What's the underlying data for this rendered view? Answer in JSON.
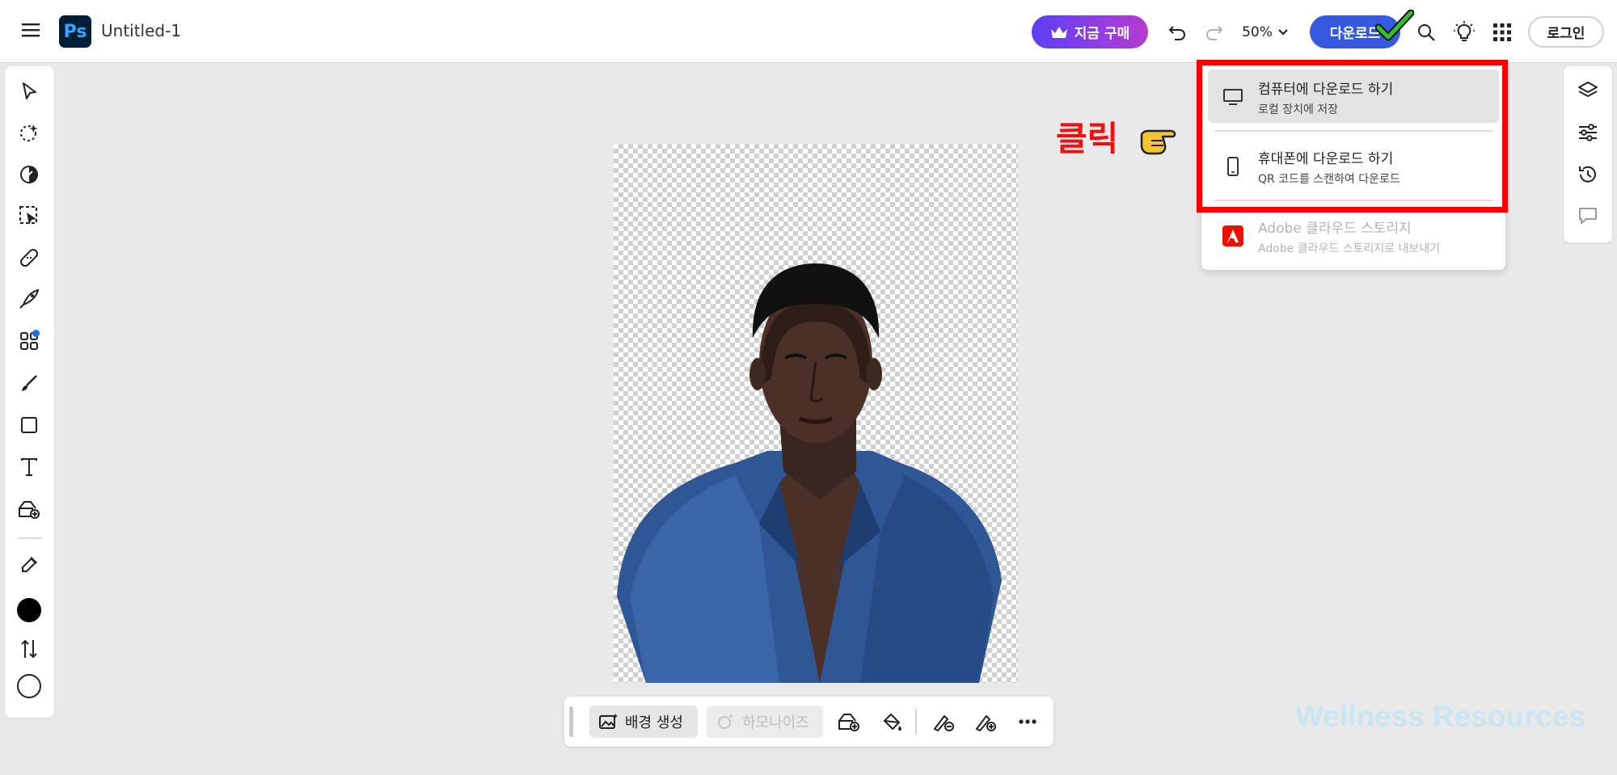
{
  "header": {
    "app_icon_label": "Ps",
    "doc_title": "Untitled-1",
    "buy_label": "지금 구매",
    "zoom_level": "50%",
    "download_label": "다운로드",
    "login_label": "로그인"
  },
  "download_menu": {
    "items": [
      {
        "title": "컴퓨터에 다운로드 하기",
        "subtitle": "로컬 장치에 저장",
        "icon": "monitor-icon",
        "active": true
      },
      {
        "title": "휴대폰에 다운로드 하기",
        "subtitle": "QR 코드를 스캔하여 다운로드",
        "icon": "phone-icon",
        "active": false
      },
      {
        "title": "Adobe 클라우드 스토리지",
        "subtitle": "Adobe 클라우드 스토리지로 내보내기",
        "icon": "adobe-icon",
        "disabled": true
      }
    ]
  },
  "annotation": {
    "click_label": "클릭",
    "highlight_color": "#ff0000",
    "hand_icon": "pointing-hand-icon",
    "check_icon": "green-check-icon"
  },
  "left_tools": [
    "select-icon",
    "quick-select-icon",
    "adjust-icon",
    "object-select-icon",
    "heal-icon",
    "quick-actions-icon",
    "add-ons-icon",
    "brush-icon",
    "shape-icon",
    "text-icon",
    "generative-fill-icon",
    "eyedropper-icon",
    "swap-colors-icon"
  ],
  "colors": {
    "foreground": "#000000",
    "background": "#ffffff",
    "accent": "#3559e0"
  },
  "right_tools": [
    "layers-icon",
    "adjustments-icon",
    "history-icon",
    "comments-icon"
  ],
  "context_bar": {
    "generate_bg_label": "배경 생성",
    "harmonize_label": "하모나이즈"
  },
  "watermark": "Wellness Resources"
}
